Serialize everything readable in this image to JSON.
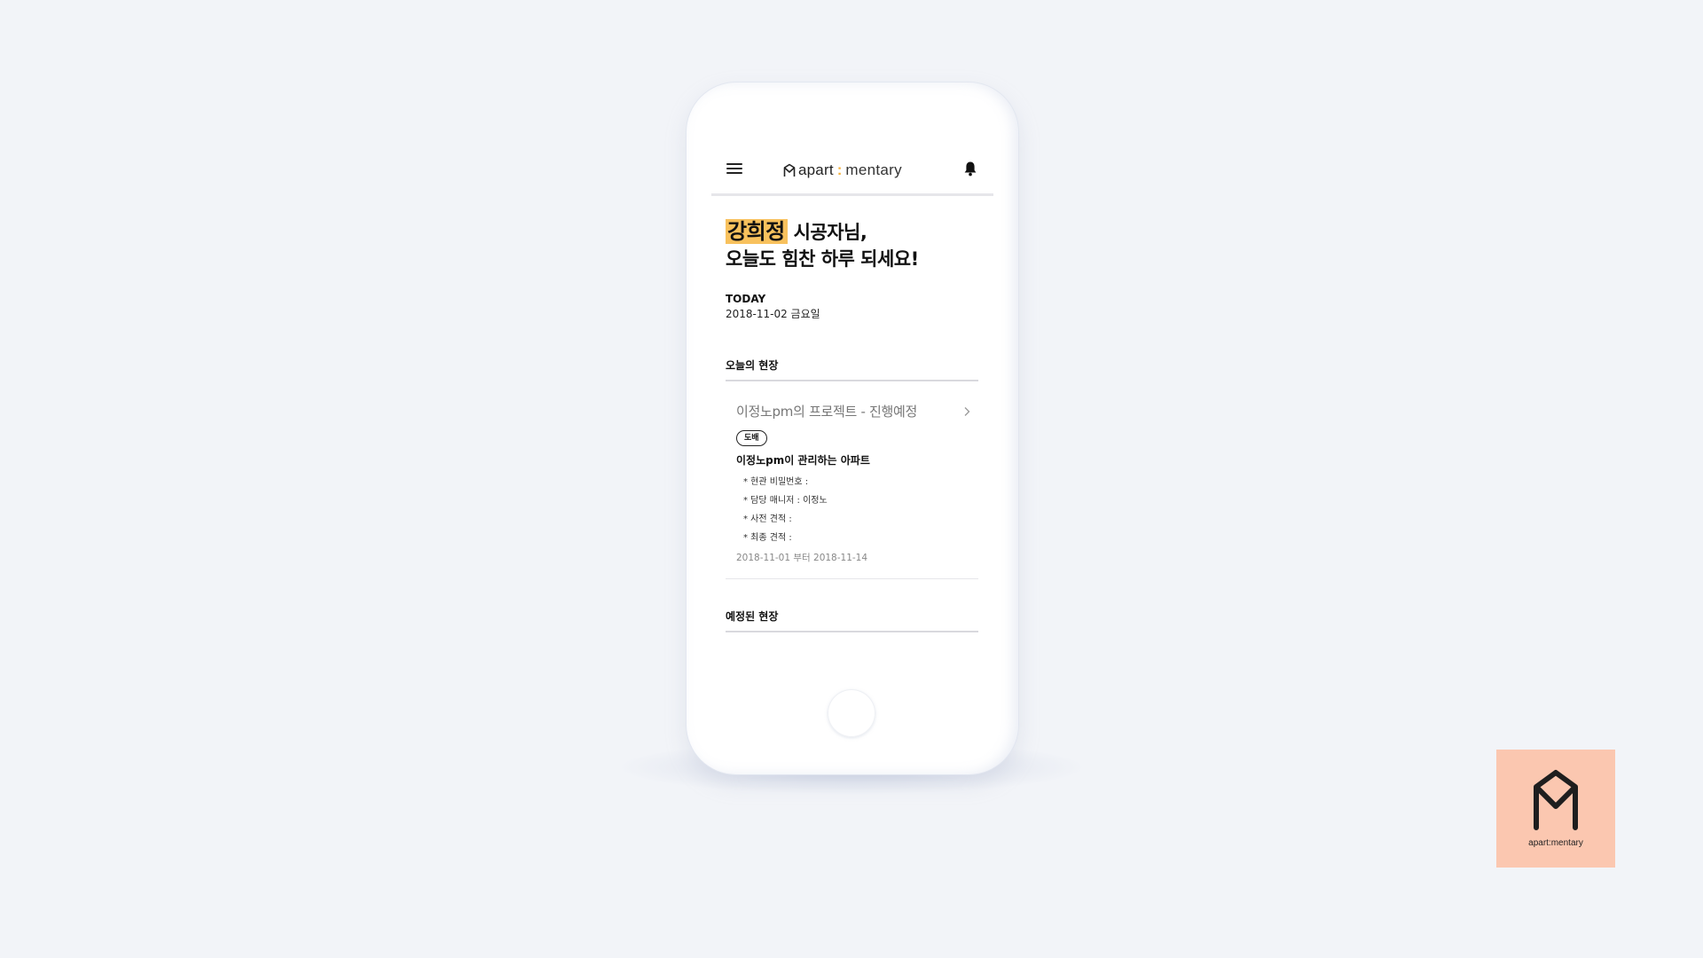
{
  "app": {
    "logo_primary": "apart",
    "logo_separator": ":",
    "logo_secondary": "mentary"
  },
  "greeting": {
    "name": "강희정",
    "line1_suffix": "시공자님,",
    "line2": "오늘도 힘찬 하루 되세요!"
  },
  "today": {
    "label": "TODAY",
    "date": "2018-11-02 금요일"
  },
  "sections": {
    "today_sites": "오늘의 현장",
    "upcoming_sites": "예정된 현장"
  },
  "site_card": {
    "title": "이정노pm의 프로젝트 - 진행예정",
    "tag": "도배",
    "name": "이정노pm이 관리하는 아파트",
    "details": [
      "* 현관 비밀번호 :",
      "* 담당 매니저 : 이정노",
      "* 사전 견적 :",
      "* 최종 견적 :"
    ],
    "period": "2018-11-01 부터 2018-11-14"
  },
  "brand_badge": {
    "text": "apart:mentary"
  },
  "colors": {
    "background": "#f2f4f8",
    "highlight": "#f8c15d",
    "badge_bg": "#fbc7b0"
  },
  "icons": [
    "menu-icon",
    "logo-icon",
    "bell-icon",
    "chevron-right-icon",
    "brand-logo-icon"
  ]
}
